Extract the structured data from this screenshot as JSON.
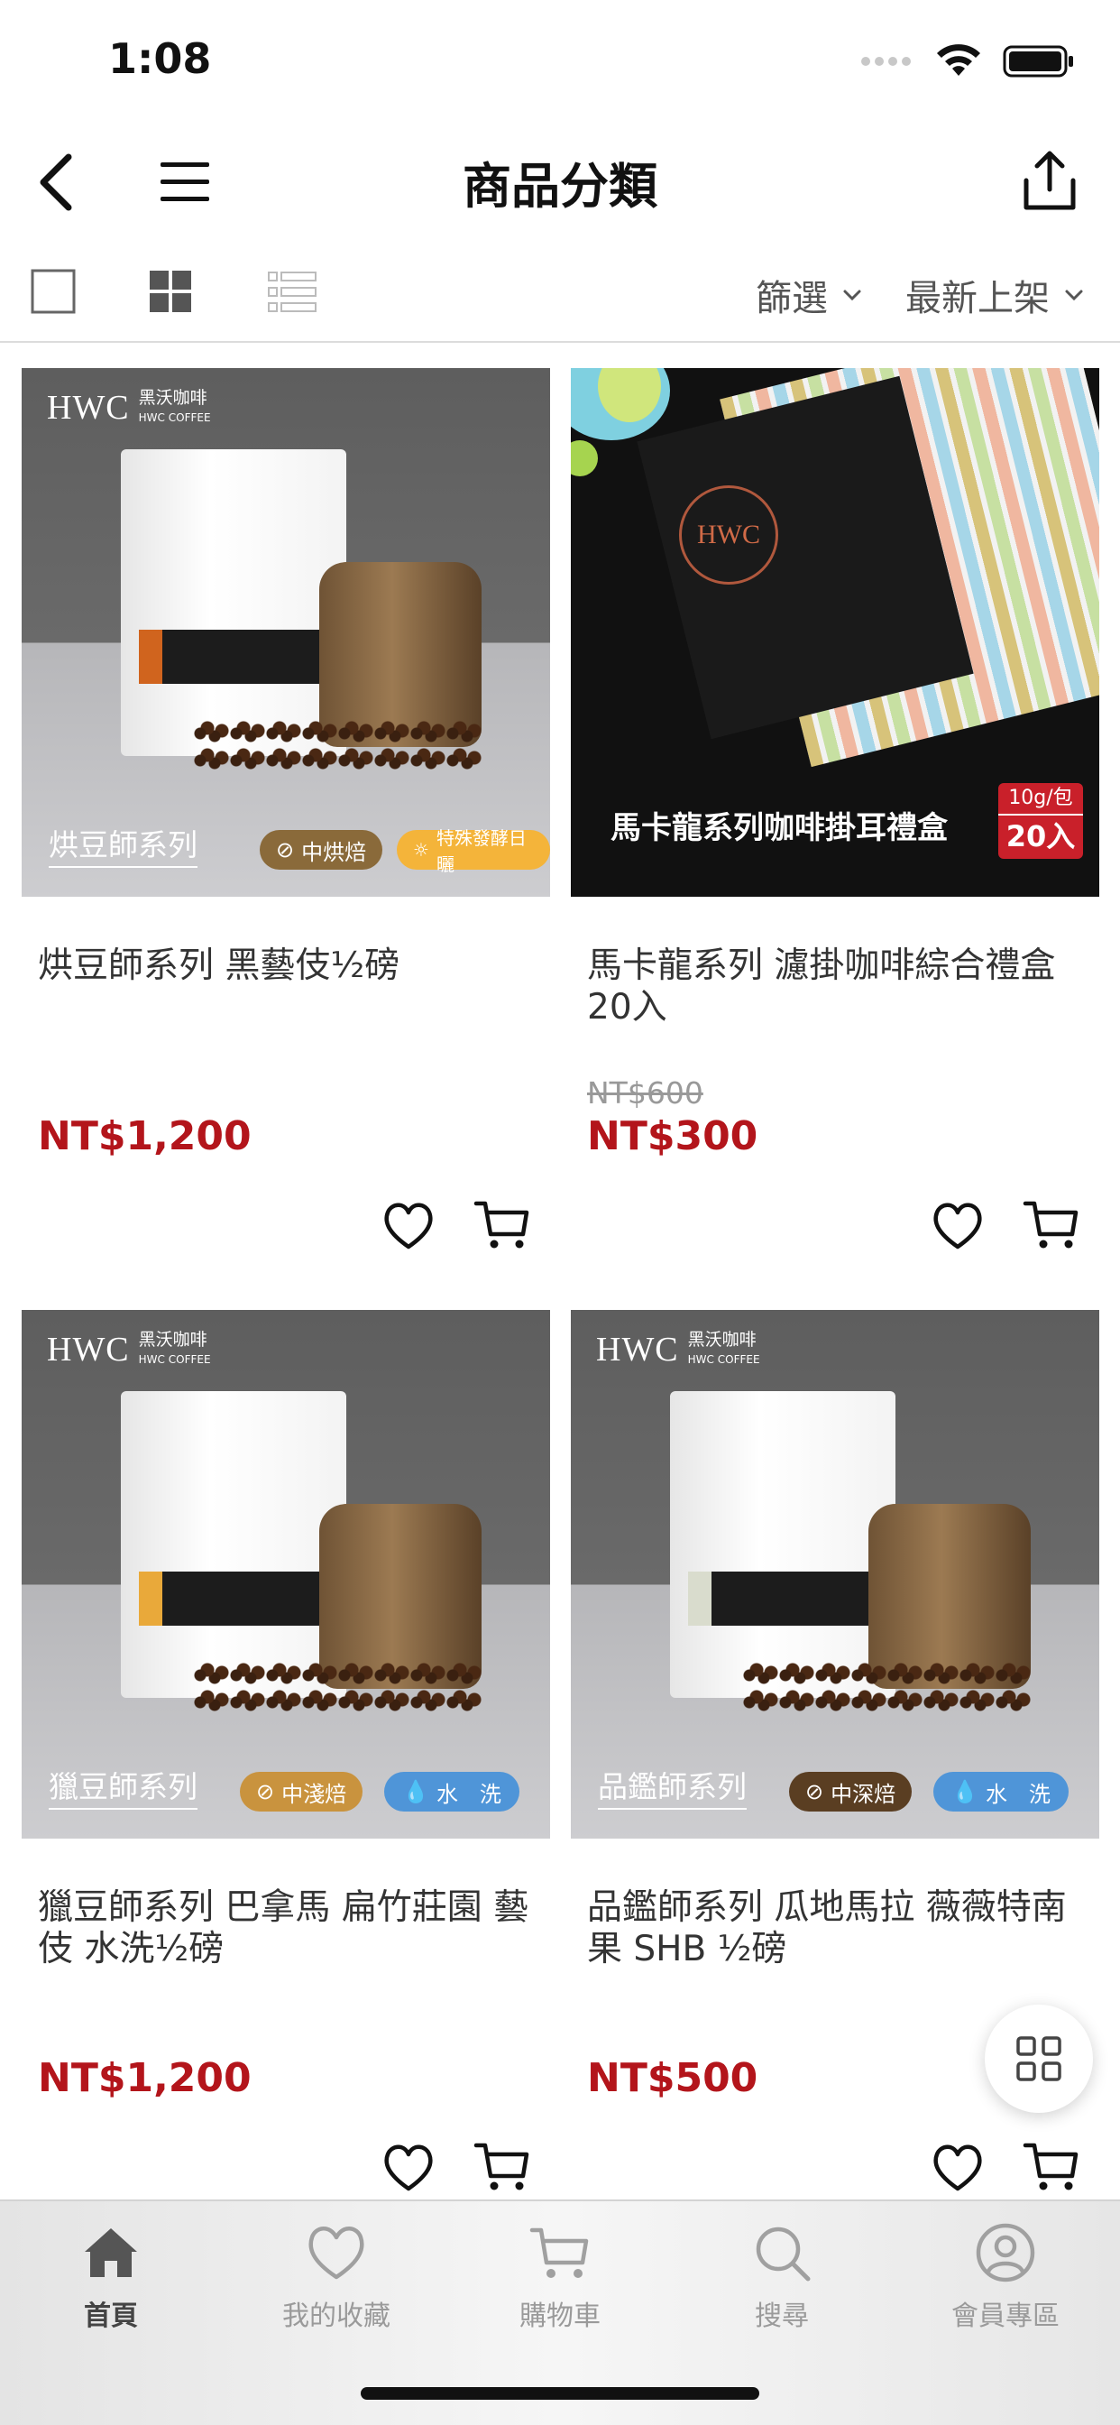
{
  "status_bar": {
    "time": "1:08"
  },
  "nav": {
    "title": "商品分類"
  },
  "toolbar": {
    "filter_label": "篩選",
    "sort_label": "最新上架"
  },
  "products": [
    {
      "image_brand": "HWC",
      "image_brand_sub_zh": "黑沃咖啡",
      "image_brand_sub_en": "HWC COFFEE",
      "image_series": "烘豆師系列",
      "tags": [
        "中烘焙",
        "特殊發酵日曬"
      ],
      "name": "烘豆師系列 黑藝伎½磅",
      "original_price": "",
      "price": "NT$1,200"
    },
    {
      "image_caption": "馬卡龍系列咖啡掛耳禮盒",
      "badge_top": "10g/包",
      "badge_bottom": "20入",
      "name": "馬卡龍系列 濾掛咖啡綜合禮盒20入",
      "original_price": "NT$600",
      "price": "NT$300"
    },
    {
      "image_brand": "HWC",
      "image_brand_sub_zh": "黑沃咖啡",
      "image_brand_sub_en": "HWC COFFEE",
      "image_series": "獵豆師系列",
      "tags": [
        "中淺焙",
        "水　洗"
      ],
      "name": "獵豆師系列 巴拿馬 扁竹莊園 藝伎 水洗½磅",
      "original_price": "",
      "price": "NT$1,200"
    },
    {
      "image_brand": "HWC",
      "image_brand_sub_zh": "黑沃咖啡",
      "image_brand_sub_en": "HWC COFFEE",
      "image_series": "品鑑師系列",
      "tags": [
        "中深焙",
        "水　洗"
      ],
      "name": "品鑑師系列 瓜地馬拉 薇薇特南果 SHB ½磅",
      "original_price": "",
      "price": "NT$500"
    }
  ],
  "tab_bar": {
    "items": [
      {
        "label": "首頁",
        "icon": "home-icon",
        "active": true
      },
      {
        "label": "我的收藏",
        "icon": "heart-icon",
        "active": false
      },
      {
        "label": "購物車",
        "icon": "cart-icon",
        "active": false
      },
      {
        "label": "搜尋",
        "icon": "search-icon",
        "active": false
      },
      {
        "label": "會員專區",
        "icon": "user-icon",
        "active": false
      }
    ]
  },
  "colors": {
    "price": "#b3151b",
    "tag_roast_brown": "#8a6a3a",
    "tag_roast_dark": "#5a3e22",
    "tag_fermented": "#f4b43a",
    "tag_washed": "#4f95d8"
  }
}
